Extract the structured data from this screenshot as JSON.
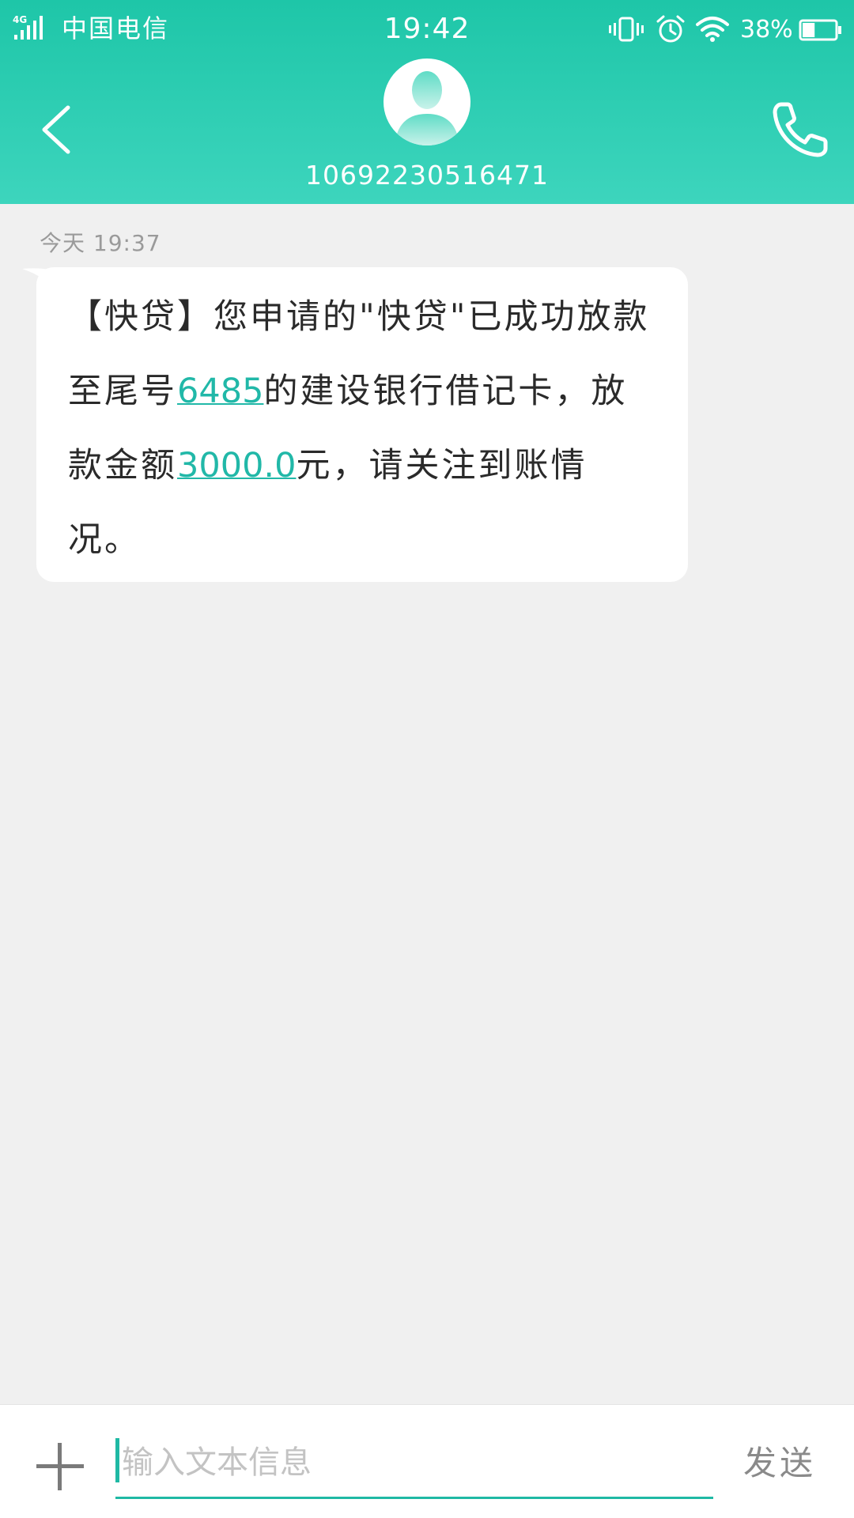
{
  "status_bar": {
    "network": "4G",
    "carrier": "中国电信",
    "time": "19:42",
    "battery_percent": "38%",
    "battery_level": 0.38,
    "icons": [
      "signal-icon",
      "vibrate-icon",
      "alarm-icon",
      "wifi-icon",
      "battery-icon"
    ]
  },
  "header": {
    "contact_number": "10692230516471",
    "back_icon": "chevron-left-icon",
    "call_icon": "phone-icon",
    "avatar_icon": "person-avatar-icon"
  },
  "conversation": {
    "timestamp": "今天 19:37",
    "message": {
      "part1": "【快贷】您申请的\"快贷\"已成功放款至尾号",
      "card_digits": "6485",
      "part2": "的建设银行借记卡，放款金额",
      "amount": "3000.0",
      "part3": "元，请关注到账情况。"
    }
  },
  "compose": {
    "placeholder": "输入文本信息",
    "send_label": "发送",
    "attach_icon": "plus-icon"
  },
  "colors": {
    "accent": "#1ec6a8",
    "link": "#21b8a8",
    "background": "#f0f0f0"
  }
}
